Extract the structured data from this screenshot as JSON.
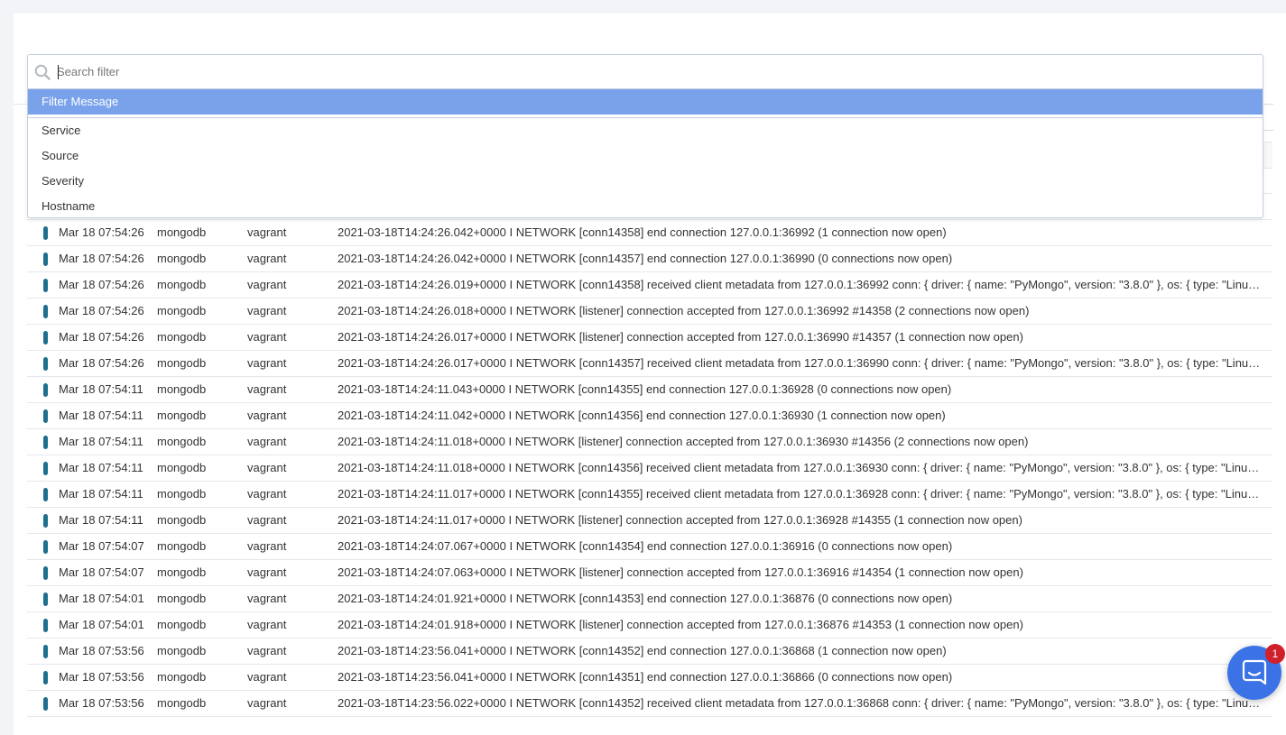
{
  "filter": {
    "placeholder": "Search filter",
    "options": [
      {
        "label": "Filter Message",
        "active": true
      },
      {
        "label": "Service",
        "active": false
      },
      {
        "label": "Source",
        "active": false
      },
      {
        "label": "Severity",
        "active": false
      },
      {
        "label": "Hostname",
        "active": false
      }
    ]
  },
  "colors": {
    "accent": "#7aa2ea",
    "severity_info": "#1e6f8e",
    "chat_button": "#3b73e6",
    "badge": "#d0202a"
  },
  "logs": [
    {
      "time": "Mar 18 07:54:26",
      "service": "mongodb",
      "source": "vagrant",
      "message": "2021-03-18T14:24:26.042+0000 I NETWORK [conn14358] end connection 127.0.0.1:36992 (1 connection now open)"
    },
    {
      "time": "Mar 18 07:54:26",
      "service": "mongodb",
      "source": "vagrant",
      "message": "2021-03-18T14:24:26.042+0000 I NETWORK [conn14357] end connection 127.0.0.1:36990 (0 connections now open)"
    },
    {
      "time": "Mar 18 07:54:26",
      "service": "mongodb",
      "source": "vagrant",
      "message": "2021-03-18T14:24:26.019+0000 I NETWORK [conn14358] received client metadata from 127.0.0.1:36992 conn: { driver: { name: \"PyMongo\", version: \"3.8.0\" }, os: { type: \"Linux\", name: \"Linux\" } }"
    },
    {
      "time": "Mar 18 07:54:26",
      "service": "mongodb",
      "source": "vagrant",
      "message": "2021-03-18T14:24:26.018+0000 I NETWORK [listener] connection accepted from 127.0.0.1:36992 #14358 (2 connections now open)"
    },
    {
      "time": "Mar 18 07:54:26",
      "service": "mongodb",
      "source": "vagrant",
      "message": "2021-03-18T14:24:26.017+0000 I NETWORK [listener] connection accepted from 127.0.0.1:36990 #14357 (1 connection now open)"
    },
    {
      "time": "Mar 18 07:54:26",
      "service": "mongodb",
      "source": "vagrant",
      "message": "2021-03-18T14:24:26.017+0000 I NETWORK [conn14357] received client metadata from 127.0.0.1:36990 conn: { driver: { name: \"PyMongo\", version: \"3.8.0\" }, os: { type: \"Linux\", name: \"Linux\" } }"
    },
    {
      "time": "Mar 18 07:54:11",
      "service": "mongodb",
      "source": "vagrant",
      "message": "2021-03-18T14:24:11.043+0000 I NETWORK [conn14355] end connection 127.0.0.1:36928 (0 connections now open)"
    },
    {
      "time": "Mar 18 07:54:11",
      "service": "mongodb",
      "source": "vagrant",
      "message": "2021-03-18T14:24:11.042+0000 I NETWORK [conn14356] end connection 127.0.0.1:36930 (1 connection now open)"
    },
    {
      "time": "Mar 18 07:54:11",
      "service": "mongodb",
      "source": "vagrant",
      "message": "2021-03-18T14:24:11.018+0000 I NETWORK [listener] connection accepted from 127.0.0.1:36930 #14356 (2 connections now open)"
    },
    {
      "time": "Mar 18 07:54:11",
      "service": "mongodb",
      "source": "vagrant",
      "message": "2021-03-18T14:24:11.018+0000 I NETWORK [conn14356] received client metadata from 127.0.0.1:36930 conn: { driver: { name: \"PyMongo\", version: \"3.8.0\" }, os: { type: \"Linux\", name: \"Linux\" } }"
    },
    {
      "time": "Mar 18 07:54:11",
      "service": "mongodb",
      "source": "vagrant",
      "message": "2021-03-18T14:24:11.017+0000 I NETWORK [conn14355] received client metadata from 127.0.0.1:36928 conn: { driver: { name: \"PyMongo\", version: \"3.8.0\" }, os: { type: \"Linux\", name: \"Linux\" } }"
    },
    {
      "time": "Mar 18 07:54:11",
      "service": "mongodb",
      "source": "vagrant",
      "message": "2021-03-18T14:24:11.017+0000 I NETWORK [listener] connection accepted from 127.0.0.1:36928 #14355 (1 connection now open)"
    },
    {
      "time": "Mar 18 07:54:07",
      "service": "mongodb",
      "source": "vagrant",
      "message": "2021-03-18T14:24:07.067+0000 I NETWORK [conn14354] end connection 127.0.0.1:36916 (0 connections now open)"
    },
    {
      "time": "Mar 18 07:54:07",
      "service": "mongodb",
      "source": "vagrant",
      "message": "2021-03-18T14:24:07.063+0000 I NETWORK [listener] connection accepted from 127.0.0.1:36916 #14354 (1 connection now open)"
    },
    {
      "time": "Mar 18 07:54:01",
      "service": "mongodb",
      "source": "vagrant",
      "message": "2021-03-18T14:24:01.921+0000 I NETWORK [conn14353] end connection 127.0.0.1:36876 (0 connections now open)"
    },
    {
      "time": "Mar 18 07:54:01",
      "service": "mongodb",
      "source": "vagrant",
      "message": "2021-03-18T14:24:01.918+0000 I NETWORK [listener] connection accepted from 127.0.0.1:36876 #14353 (1 connection now open)"
    },
    {
      "time": "Mar 18 07:53:56",
      "service": "mongodb",
      "source": "vagrant",
      "message": "2021-03-18T14:23:56.041+0000 I NETWORK [conn14352] end connection 127.0.0.1:36868 (1 connection now open)"
    },
    {
      "time": "Mar 18 07:53:56",
      "service": "mongodb",
      "source": "vagrant",
      "message": "2021-03-18T14:23:56.041+0000 I NETWORK [conn14351] end connection 127.0.0.1:36866 (0 connections now open)"
    },
    {
      "time": "Mar 18 07:53:56",
      "service": "mongodb",
      "source": "vagrant",
      "message": "2021-03-18T14:23:56.022+0000 I NETWORK [conn14352] received client metadata from 127.0.0.1:36868 conn: { driver: { name: \"PyMongo\", version: \"3.8.0\" }, os: { type: \"Linux\", name: \"Linux\" } }"
    }
  ],
  "chat": {
    "icon": "chat-bubble-icon",
    "badge_count": "1"
  }
}
